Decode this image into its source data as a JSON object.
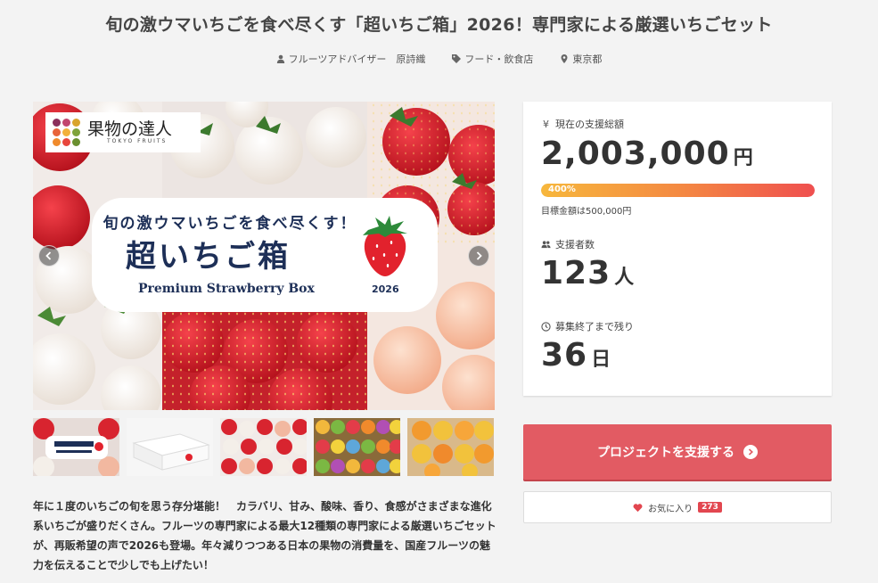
{
  "project": {
    "title": "旬の激ウマいちごを食べ尽くす「超いちご箱」2026！専門家による厳選いちごセット",
    "meta": {
      "owner": "フルーツアドバイザー　原詩織",
      "category": "フード・飲食店",
      "location": "東京都"
    },
    "description": "年に１度のいちごの旬を思う存分堪能！　カラバリ、甘み、酸味、香り、食感がさまざまな進化系いちごが盛りだくさん。フルーツの専門家による最大12種類の専門家による厳選いちごセットが、再販希望の声で2026も登場。年々減りつつある日本の果物の消費量を、国産フルーツの魅力を伝えることで少しでも上げたい！"
  },
  "hero": {
    "logo_main": "果物の達人",
    "logo_sub": "TOKYO FRUITS",
    "banner_line1": "旬の激ウマいちごを食べ尽くす！",
    "banner_line2": "超いちご箱",
    "banner_line3": "Premium Strawberry Box",
    "banner_year": "2026",
    "prev_icon": "chevron-left-icon",
    "next_icon": "chevron-right-icon"
  },
  "stats": {
    "amount_label": "現在の支援総額",
    "amount_value": "2,003,000",
    "amount_unit": "円",
    "progress_percent": 400,
    "progress_text": "400%",
    "goal_text": "目標金額は500,000円",
    "supporters_label": "支援者数",
    "supporters_value": "123",
    "supporters_unit": "人",
    "remaining_label": "募集終了まで残り",
    "remaining_value": "36",
    "remaining_unit": "日"
  },
  "actions": {
    "support_label": "プロジェクトを支援する",
    "favorite_label": "お気に入り",
    "favorite_count": "273"
  },
  "colors": {
    "accent": "#e25b63",
    "heart": "#e2464f",
    "banner_text": "#1d2f57"
  }
}
